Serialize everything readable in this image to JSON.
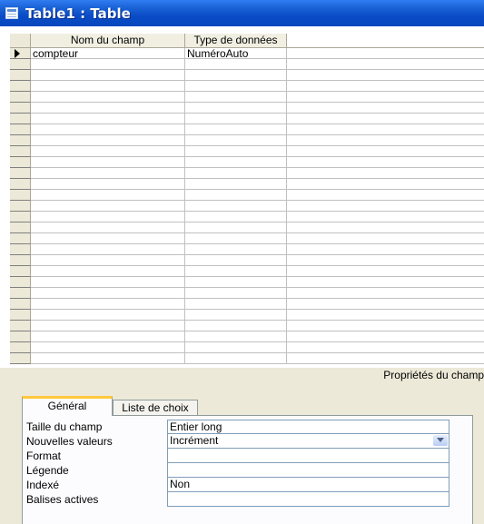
{
  "window": {
    "title": "Table1 : Table"
  },
  "grid": {
    "columns": [
      "Nom du champ",
      "Type de données"
    ],
    "rows": [
      {
        "name": "compteur",
        "type": "NuméroAuto"
      }
    ],
    "empty_rows": 28
  },
  "properties": {
    "section_label": "Propriétés du champ",
    "tabs": [
      "Général",
      "Liste de choix"
    ],
    "active_tab": "Général",
    "fields": [
      {
        "label": "Taille du champ",
        "value": "Entier long"
      },
      {
        "label": "Nouvelles valeurs",
        "value": "Incrément",
        "dropdown": true
      },
      {
        "label": "Format",
        "value": ""
      },
      {
        "label": "Légende",
        "value": ""
      },
      {
        "label": "Indexé",
        "value": "Non"
      },
      {
        "label": "Balises actives",
        "value": ""
      }
    ]
  },
  "colors": {
    "titlebar": "#0a4cc6",
    "active_tab_accent": "#ffc83c"
  }
}
